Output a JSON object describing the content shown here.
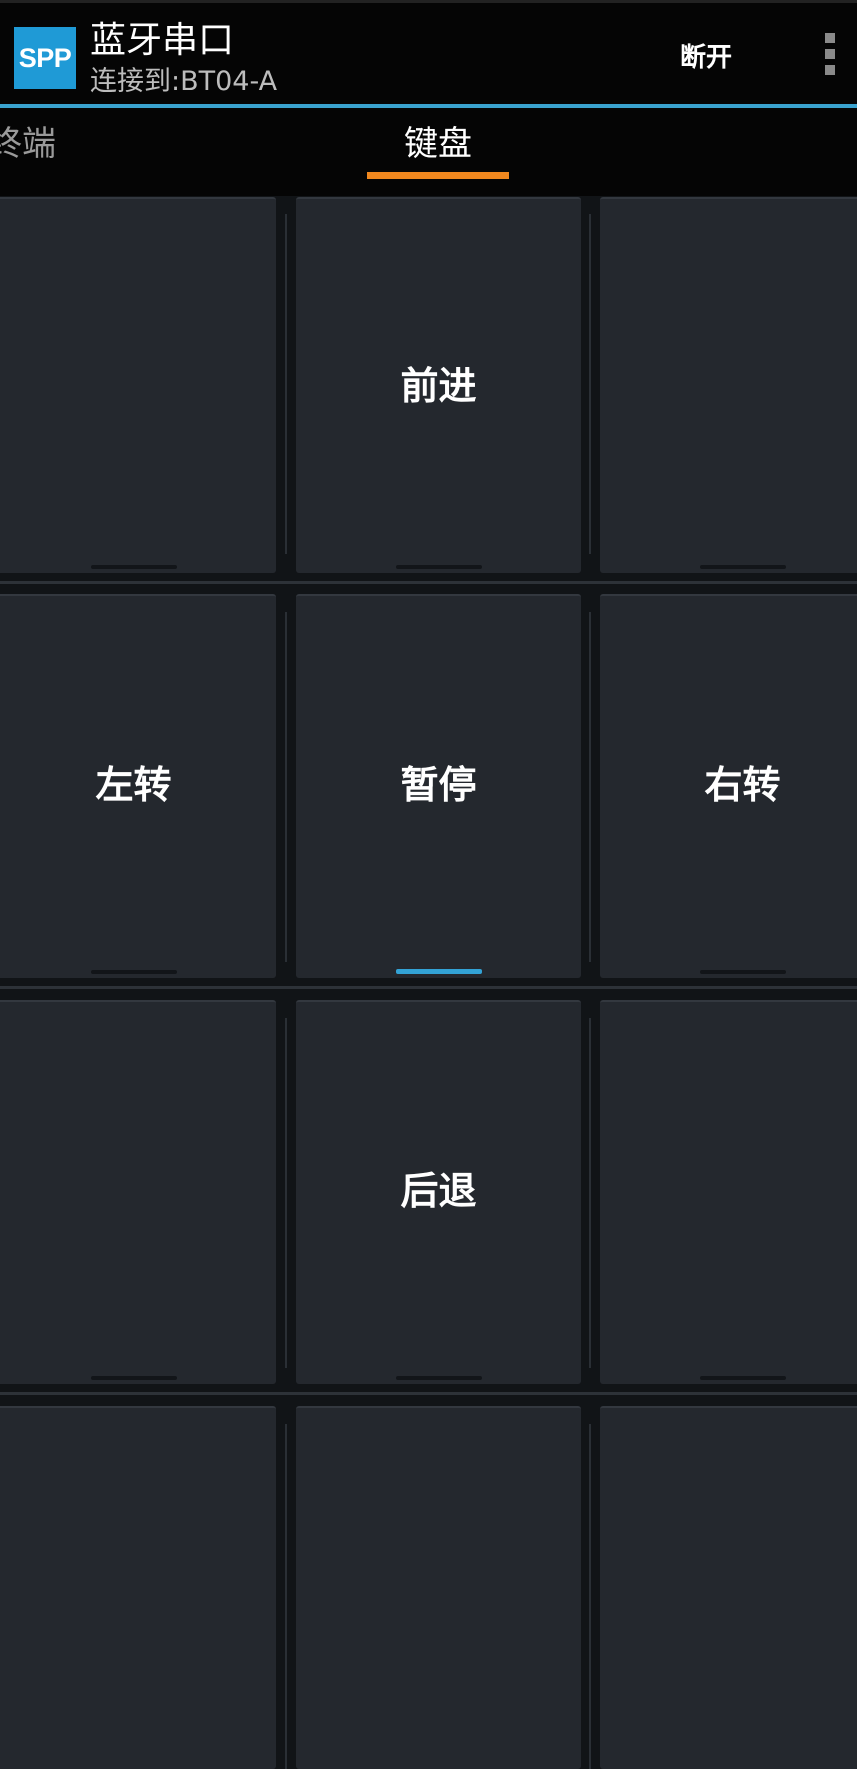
{
  "header": {
    "app_icon_text": "SPP",
    "title": "蓝牙串口",
    "subtitle": "连接到:BT04-A",
    "disconnect_label": "断开",
    "menu_icon": "overflow-menu-icon",
    "accent_color": "#3aa3cf"
  },
  "tabs": [
    {
      "label": "终端",
      "selected": false
    },
    {
      "label": "键盘",
      "selected": true
    }
  ],
  "tab_indicator_color": "#f0871e",
  "keyboard": {
    "rows": [
      [
        "",
        "前进",
        ""
      ],
      [
        "左转",
        "暂停",
        "右转"
      ],
      [
        "",
        "后退",
        ""
      ],
      [
        "",
        "",
        ""
      ]
    ],
    "active_key": "暂停",
    "active_indicator_color": "#33a3d6"
  }
}
